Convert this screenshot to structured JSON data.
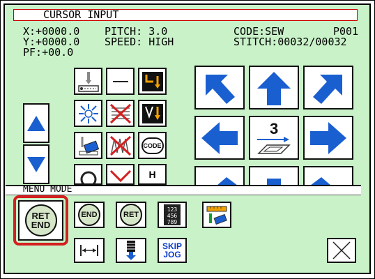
{
  "screen": {
    "title": "CURSOR INPUT",
    "x_label": "X:+0000.0",
    "y_label": "Y:+0000.0",
    "pf_label": "PF:+00.0",
    "pitch_label": "PITCH: 3.0",
    "speed_label": "SPEED: HIGH",
    "code_label": "CODE:SEW",
    "page_label": "P001",
    "stitch_label": "STITCH:00032/00032"
  },
  "direction_pad": {
    "center_digit": "3"
  },
  "menu": {
    "label": "MENU MODE",
    "ret_end_top": "RET",
    "ret_end_bottom": "END",
    "end_label": "END",
    "ret_label": "RET",
    "skip_label": "SKIP",
    "jog_label": "JOG",
    "numpad_label": "123 456 789"
  },
  "small_buttons": {
    "code_label": "CODE",
    "h_label": "H"
  },
  "colors": {
    "panel_bg": "#c9f2c9",
    "arrow_blue": "#1a5fd0",
    "highlight_red": "#d42020"
  }
}
